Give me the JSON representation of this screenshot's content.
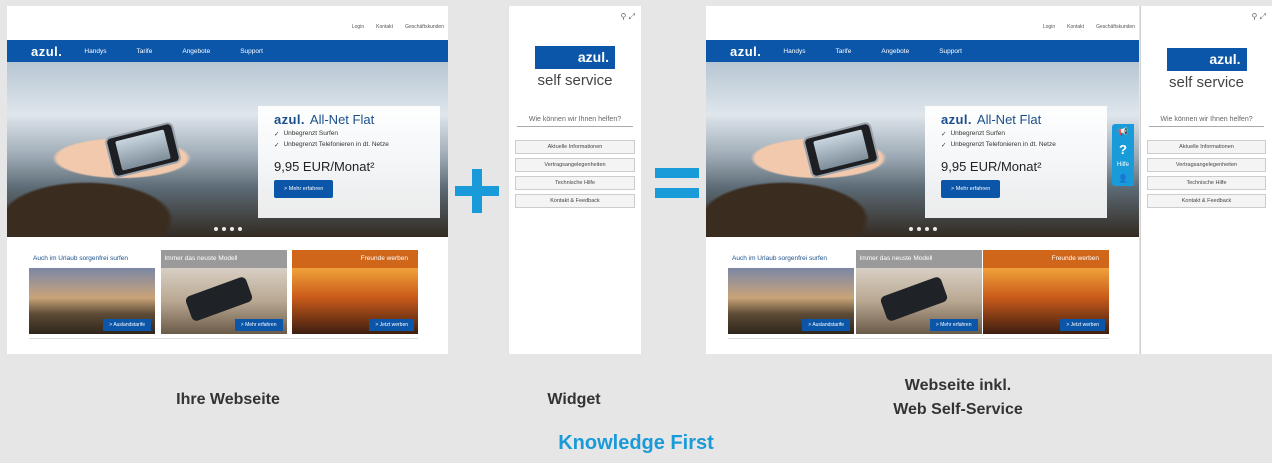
{
  "site": {
    "toplinks": [
      "Login",
      "Kontakt",
      "Geschäftskunden"
    ],
    "logo": "azul.",
    "nav": [
      "Handys",
      "Tarife",
      "Angebote",
      "Support"
    ],
    "promo": {
      "brand": "azul.",
      "title": "All-Net Flat",
      "bullets": [
        "Unbegrenzt Surfen",
        "Unbegrenzt Telefonieren in dt. Netze"
      ],
      "price": "9,95 EUR/Monat²",
      "button": "> Mehr erfahren"
    },
    "teasers": [
      {
        "label": "Auch im Urlaub sorgenfrei surfen",
        "button": "> Auslandstarife"
      },
      {
        "label": "Immer das neuste Modell",
        "button": "> Mehr erfahren"
      },
      {
        "label": "Freunde werben",
        "button": "> Jetzt werben"
      }
    ]
  },
  "widget": {
    "logo": "azul.",
    "subtitle": "self service",
    "question": "Wie können wir Ihnen helfen?",
    "buttons": [
      "Aktuelle Informationen",
      "Vertragsangelegenheiten",
      "Technische Hilfe",
      "Kontakt & Feedback"
    ],
    "tab_label": "Hilfe"
  },
  "captions": {
    "website": "Ihre Webseite",
    "widget": "Widget",
    "combined_line1": "Webseite inkl.",
    "combined_line2": "Web Self-Service"
  },
  "footer": "Knowledge First",
  "colors": {
    "brand_blue": "#0b56a8",
    "accent": "#1a9bd9"
  }
}
